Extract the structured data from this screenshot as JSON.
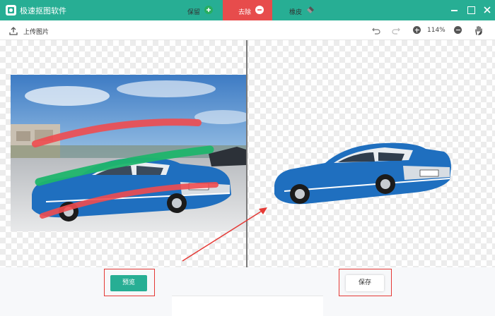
{
  "app": {
    "title": "极速抠图软件"
  },
  "toolbar": {
    "upload_label": "上传图片",
    "zoom": "114%"
  },
  "actions": {
    "preview_label": "预览",
    "save_label": "保存"
  },
  "tools": {
    "keep_label": "保留",
    "remove_label": "去除",
    "eraser_label": "橡皮"
  },
  "colors": {
    "accent": "#27ae94",
    "danger": "#e74c4c",
    "annotation": "#e53935"
  },
  "icons": [
    "app-logo-icon",
    "minimize-icon",
    "maximize-icon",
    "close-icon",
    "upload-icon",
    "undo-icon",
    "redo-icon",
    "zoom-in-icon",
    "zoom-out-icon",
    "hand-icon",
    "plus-circle-icon",
    "minus-circle-icon",
    "eraser-icon"
  ]
}
